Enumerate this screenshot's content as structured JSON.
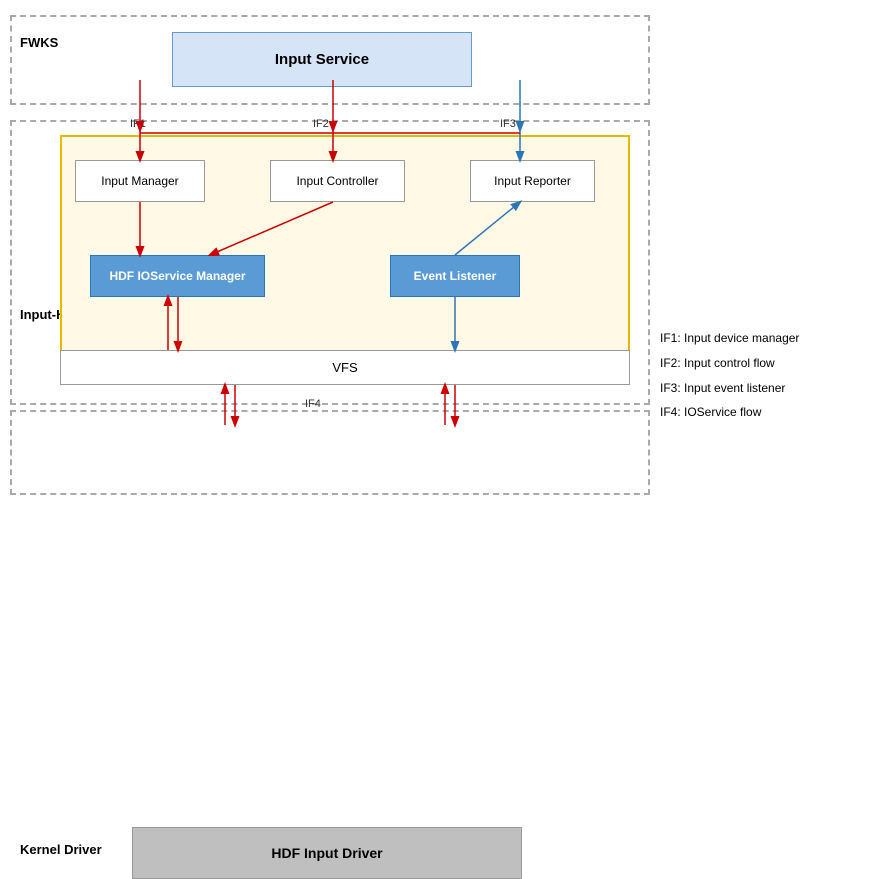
{
  "layers": {
    "fwks": {
      "label": "FWKS",
      "input_service": "Input Service"
    },
    "hdi": {
      "label": "Input-HDI",
      "inner_boxes": {
        "input_manager": "Input Manager",
        "input_controller": "Input Controller",
        "input_reporter": "Input Reporter",
        "hdf_ioservice": "HDF IOService Manager",
        "event_listener": "Event Listener"
      },
      "vfs": "VFS"
    },
    "kernel": {
      "label": "Kernel Driver",
      "hdf_input_driver": "HDF Input Driver"
    }
  },
  "interface_labels": {
    "if1": "IF1",
    "if2": "IF2",
    "if3": "IF3",
    "if4": "IF4"
  },
  "legend": {
    "if1": "IF1: Input device manager",
    "if2": "IF2: Input control flow",
    "if3": "IF3: Input event listener",
    "if4": "IF4:  IOService flow"
  },
  "colors": {
    "red_arrow": "#cc0000",
    "blue_arrow": "#2e75b6",
    "border_dashed": "#aaaaaa",
    "fwks_bg": "#d6e4f7",
    "hdi_inner_bg": "#fff9e6",
    "blue_box": "#5b9bd5",
    "kernel_box": "#bfbfbf"
  }
}
